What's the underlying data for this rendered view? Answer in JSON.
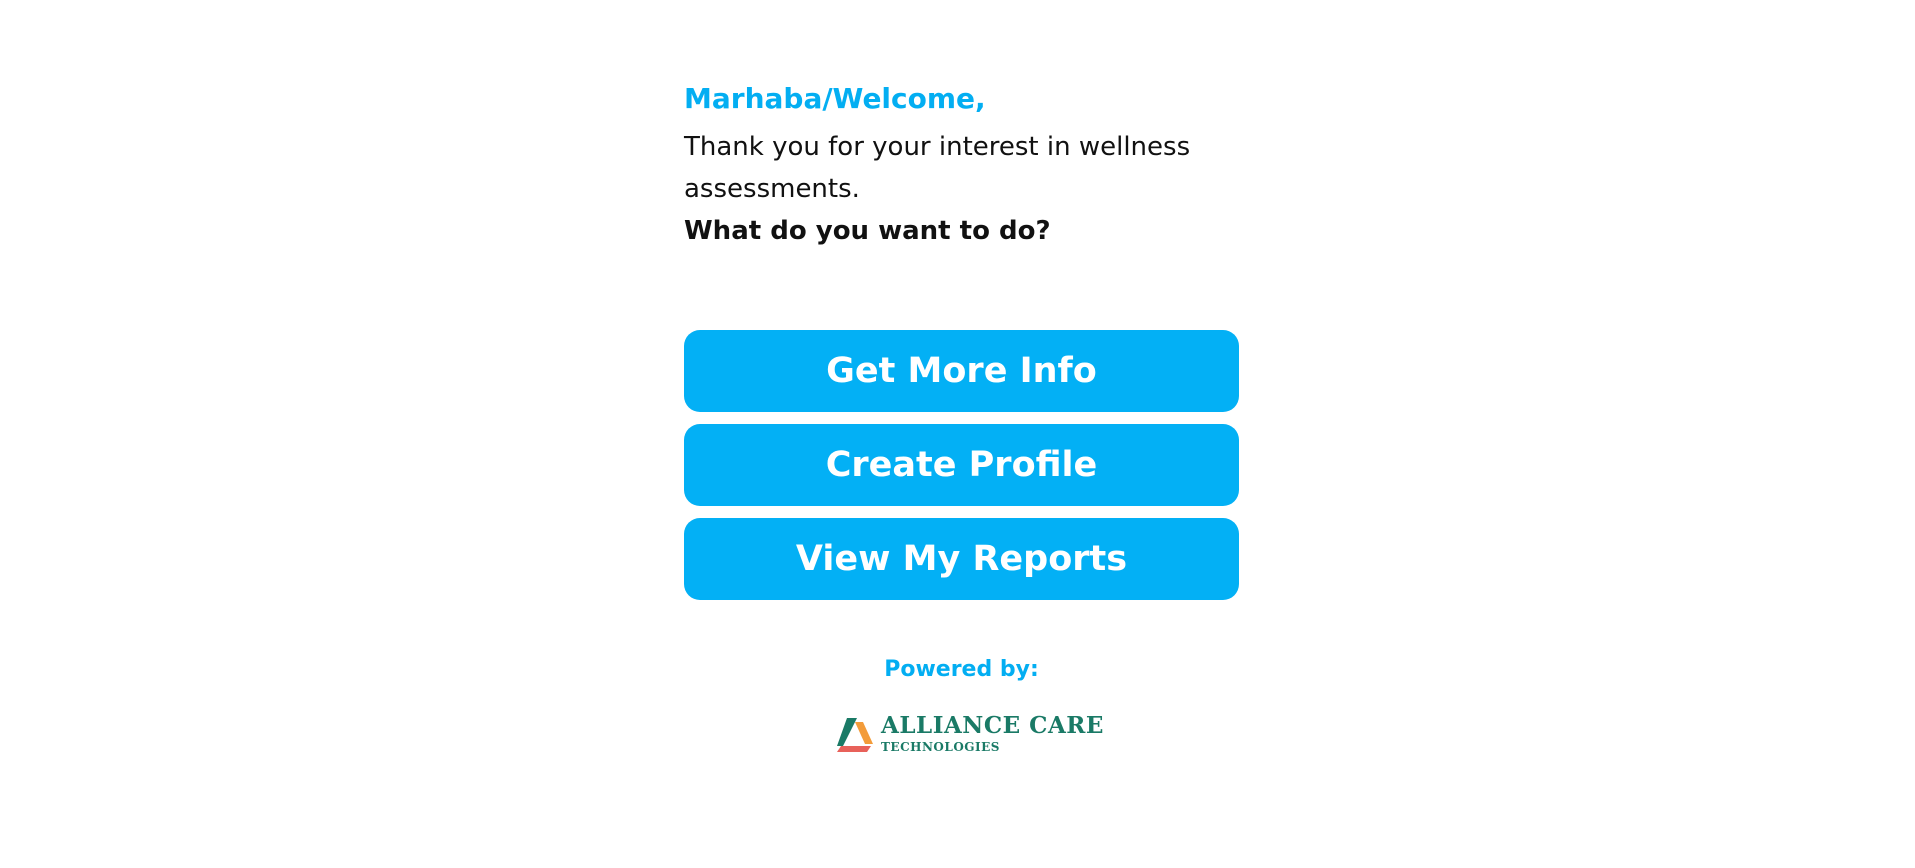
{
  "welcome": {
    "greeting": "Marhaba/Welcome,",
    "intro": "Thank you for your interest in wellness assessments.",
    "question": "What do you want to do?"
  },
  "actions": {
    "more_info_label": "Get More Info",
    "create_profile_label": "Create Profile",
    "view_reports_label": "View My Reports",
    "button_color": "#03b0f5"
  },
  "footer": {
    "powered_by": "Powered by:",
    "logo_title": "ALLIANCE CARE",
    "logo_subtitle": "TECHNOLOGIES",
    "logo_color": "#1a7a66",
    "logo_icon": "alliance-care-triangle-logo"
  },
  "colors": {
    "accent": "#03aef2",
    "text": "#111111"
  }
}
